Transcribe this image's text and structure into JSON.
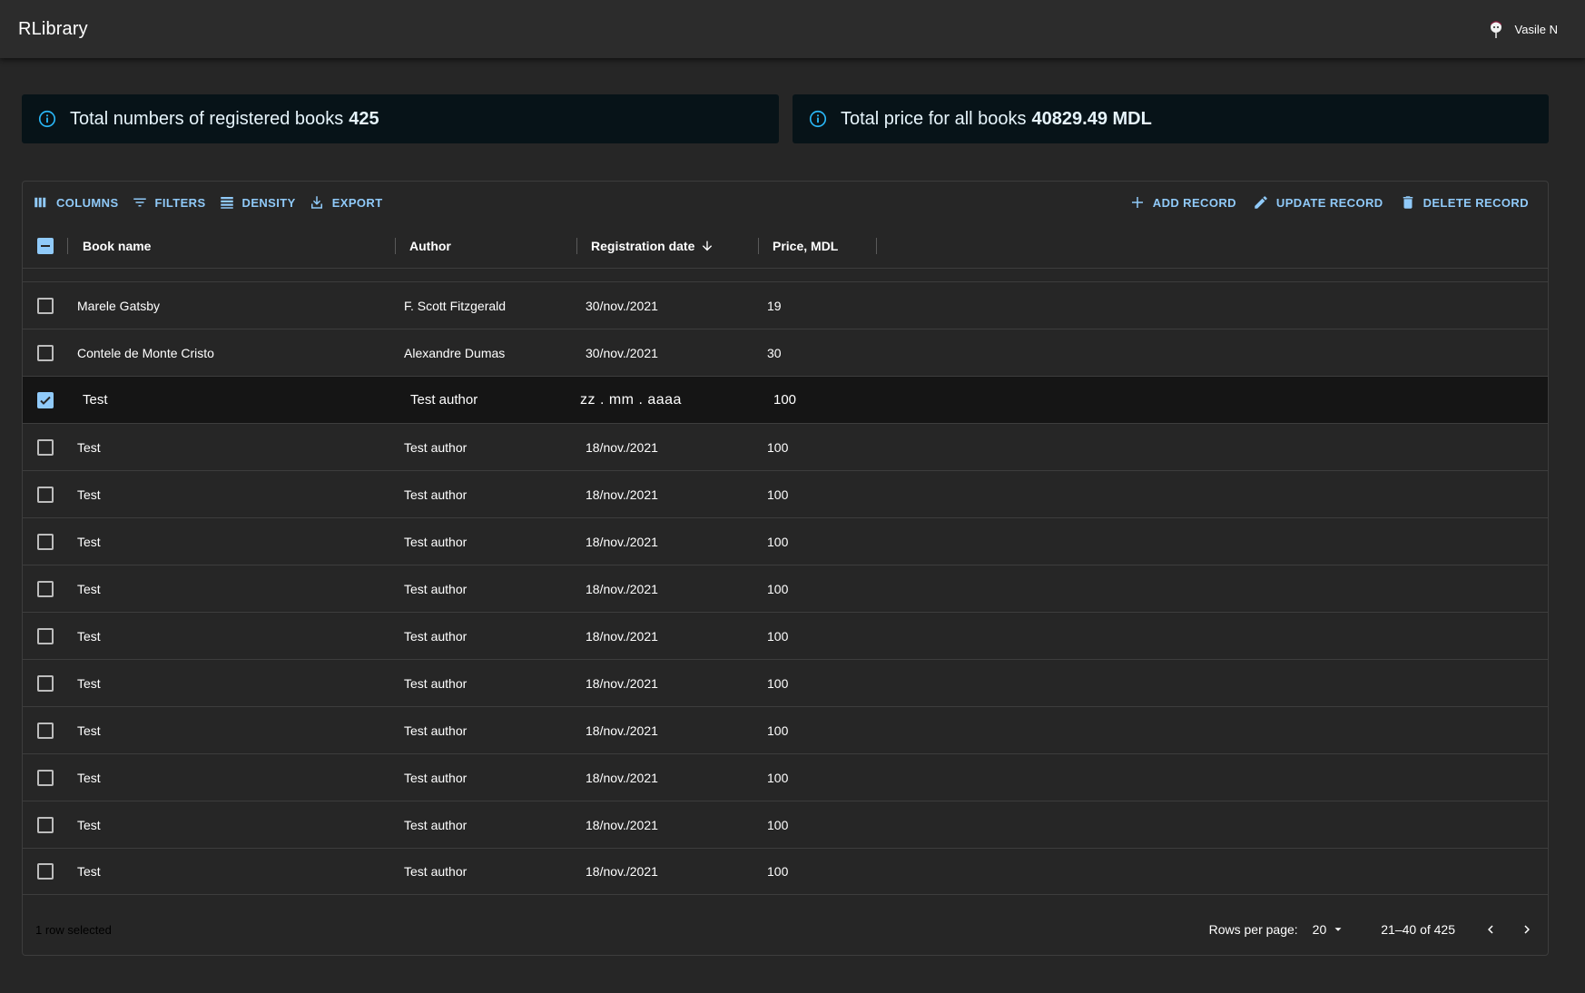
{
  "app": {
    "title": "RLibrary",
    "user_name": "Vasile N"
  },
  "stats": {
    "books_label": "Total numbers of registered books",
    "books_value": "425",
    "price_label": "Total price for all books",
    "price_value": "40829.49 MDL"
  },
  "toolbar": {
    "columns": "COLUMNS",
    "filters": "FILTERS",
    "density": "DENSITY",
    "export": "EXPORT",
    "add": "ADD RECORD",
    "update": "UPDATE RECORD",
    "delete": "DELETE RECORD"
  },
  "columns": {
    "name": "Book name",
    "author": "Author",
    "date": "Registration date",
    "price": "Price, MDL"
  },
  "rows": [
    {
      "name": "Marele Gatsby",
      "author": "F. Scott Fitzgerald",
      "date": "30/nov./2021",
      "price": "19",
      "checked": false
    },
    {
      "name": "Contele de Monte Cristo",
      "author": "Alexandre Dumas",
      "date": "30/nov./2021",
      "price": "30",
      "checked": false
    },
    {
      "name": "Test",
      "author": "Test author",
      "date": "zz . mm . aaaa",
      "price": "100",
      "checked": true
    },
    {
      "name": "Test",
      "author": "Test author",
      "date": "18/nov./2021",
      "price": "100",
      "checked": false
    },
    {
      "name": "Test",
      "author": "Test author",
      "date": "18/nov./2021",
      "price": "100",
      "checked": false
    },
    {
      "name": "Test",
      "author": "Test author",
      "date": "18/nov./2021",
      "price": "100",
      "checked": false
    },
    {
      "name": "Test",
      "author": "Test author",
      "date": "18/nov./2021",
      "price": "100",
      "checked": false
    },
    {
      "name": "Test",
      "author": "Test author",
      "date": "18/nov./2021",
      "price": "100",
      "checked": false
    },
    {
      "name": "Test",
      "author": "Test author",
      "date": "18/nov./2021",
      "price": "100",
      "checked": false
    },
    {
      "name": "Test",
      "author": "Test author",
      "date": "18/nov./2021",
      "price": "100",
      "checked": false
    },
    {
      "name": "Test",
      "author": "Test author",
      "date": "18/nov./2021",
      "price": "100",
      "checked": false
    },
    {
      "name": "Test",
      "author": "Test author",
      "date": "18/nov./2021",
      "price": "100",
      "checked": false
    },
    {
      "name": "Test",
      "author": "Test author",
      "date": "18/nov./2021",
      "price": "100",
      "checked": false
    }
  ],
  "footer": {
    "selected": "1 row selected",
    "rows_per_page_label": "Rows per page:",
    "rows_per_page_value": "20",
    "range": "21–40 of 425"
  },
  "colors": {
    "accent": "#90caf9",
    "card_bg": "#071318",
    "page_bg": "#262626",
    "appbar_bg": "#2c2c2c"
  },
  "icons": [
    "avatar-icon",
    "info-icon",
    "columns-icon",
    "filter-icon",
    "density-icon",
    "export-icon",
    "add-icon",
    "edit-icon",
    "delete-icon",
    "sort-down-icon",
    "chevron-down-icon",
    "chevron-left-icon",
    "chevron-right-icon"
  ]
}
